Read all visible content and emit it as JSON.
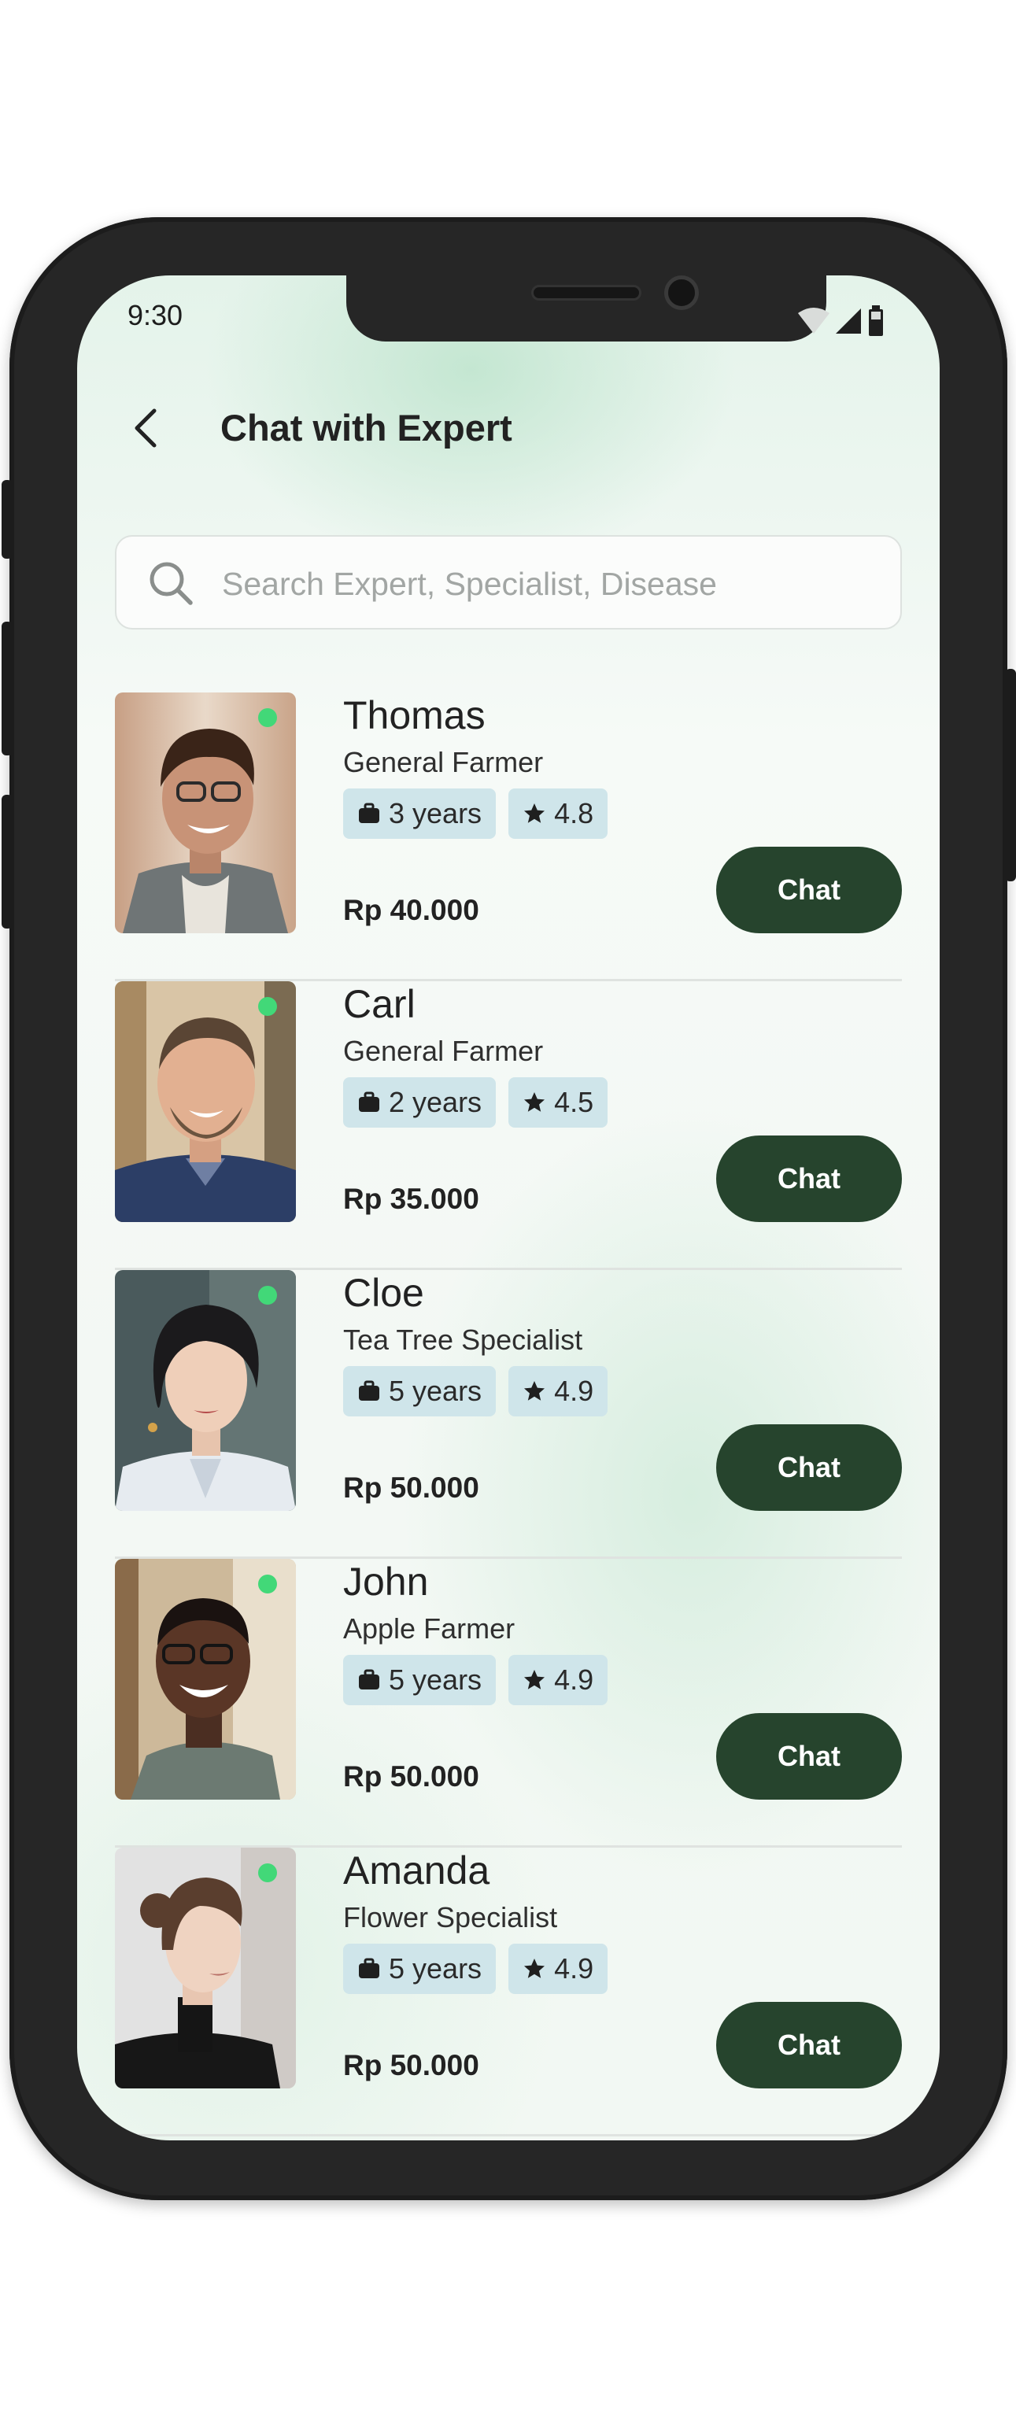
{
  "status_bar": {
    "time": "9:30",
    "icons": [
      "wifi-icon",
      "signal-icon",
      "battery-icon"
    ]
  },
  "header": {
    "back_icon": "chevron-left-icon",
    "title": "Chat with Expert"
  },
  "search": {
    "icon": "search-icon",
    "placeholder": "Search Expert, Specialist, Disease",
    "value": ""
  },
  "experts": [
    {
      "name": "Thomas",
      "role": "General Farmer",
      "experience": "3 years",
      "rating": "4.8",
      "price": "Rp 40.000",
      "online": true,
      "chat_label": "Chat"
    },
    {
      "name": "Carl",
      "role": "General Farmer",
      "experience": "2 years",
      "rating": "4.5",
      "price": "Rp 35.000",
      "online": true,
      "chat_label": "Chat"
    },
    {
      "name": "Cloe",
      "role": "Tea Tree Specialist",
      "experience": "5 years",
      "rating": "4.9",
      "price": "Rp 50.000",
      "online": true,
      "chat_label": "Chat"
    },
    {
      "name": "John",
      "role": "Apple Farmer",
      "experience": "5 years",
      "rating": "4.9",
      "price": "Rp 50.000",
      "online": true,
      "chat_label": "Chat"
    },
    {
      "name": "Amanda",
      "role": "Flower Specialist",
      "experience": "5 years",
      "rating": "4.9",
      "price": "Rp 50.000",
      "online": true,
      "chat_label": "Chat"
    }
  ],
  "colors": {
    "accent": "#26442d",
    "chip_bg": "#cfe5ea",
    "online": "#42d878",
    "background": "#eef7f1"
  }
}
